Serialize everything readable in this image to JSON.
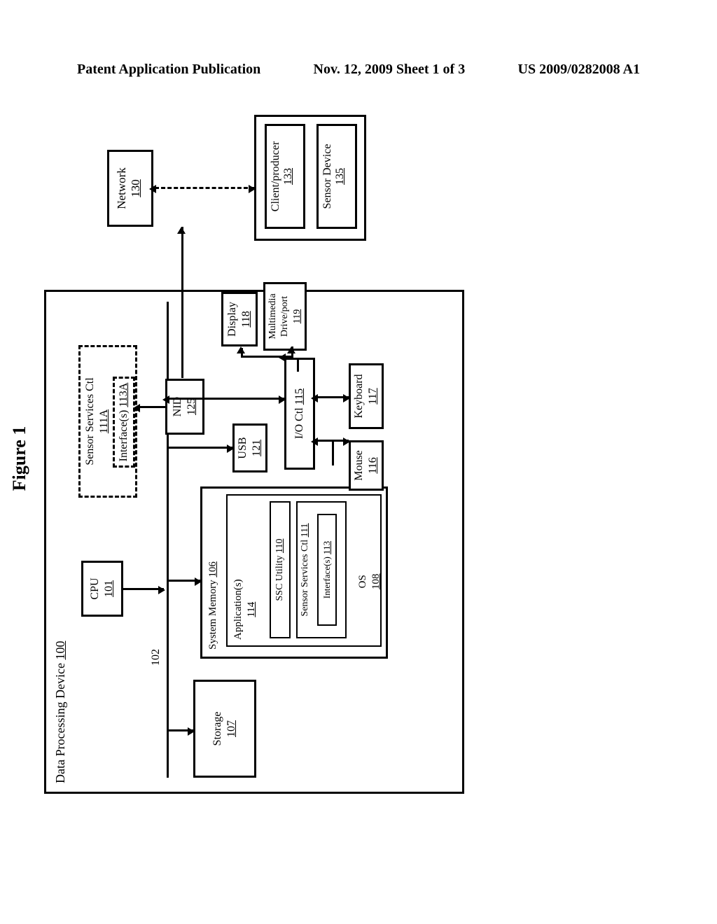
{
  "header": {
    "left": "Patent Application Publication",
    "center": "Nov. 12, 2009  Sheet 1 of 3",
    "right": "US 2009/0282008 A1"
  },
  "figure": {
    "title": "Figure 1",
    "dps": {
      "label": "Data Processing Device",
      "ref": "100",
      "cpu": {
        "label": "CPU",
        "ref": "101"
      },
      "bus_ref": "102",
      "ssc_a": {
        "label": "Sensor Services Ctl",
        "ref": "111A"
      },
      "iface_a": {
        "label": "Interface(s)",
        "ref": "113A"
      },
      "storage": {
        "label": "Storage",
        "ref": "107"
      },
      "sysmem": {
        "label": "System Memory",
        "ref": "106"
      },
      "app": {
        "label": "Application(s)",
        "ref": "114"
      },
      "ssc_util": {
        "label": "SSC Utility",
        "ref": "110"
      },
      "ssc_ctl": {
        "label": "Sensor Services Ctl",
        "ref": "111"
      },
      "iface_b": {
        "label": "Interface(s)",
        "ref": "113"
      },
      "os": {
        "label": "OS",
        "ref": "108"
      },
      "nid": {
        "label": "NID",
        "ref": "125"
      },
      "usb": {
        "label": "USB",
        "ref": "121"
      },
      "ioctl": {
        "label": "I/O Ctl",
        "ref": "115"
      },
      "display": {
        "label": "Display",
        "ref": "118"
      },
      "mmdp": {
        "label": "Multimedia Drive/port",
        "ref": "119"
      },
      "keyboard": {
        "label": "Keyboard",
        "ref": "117"
      },
      "mouse": {
        "label": "Mouse",
        "ref": "116"
      }
    },
    "network": {
      "label": "Network",
      "ref": "130"
    },
    "client": {
      "label": "Client/producer",
      "ref": "133"
    },
    "sensor_dev": {
      "label": "Sensor Device",
      "ref": "135"
    }
  }
}
